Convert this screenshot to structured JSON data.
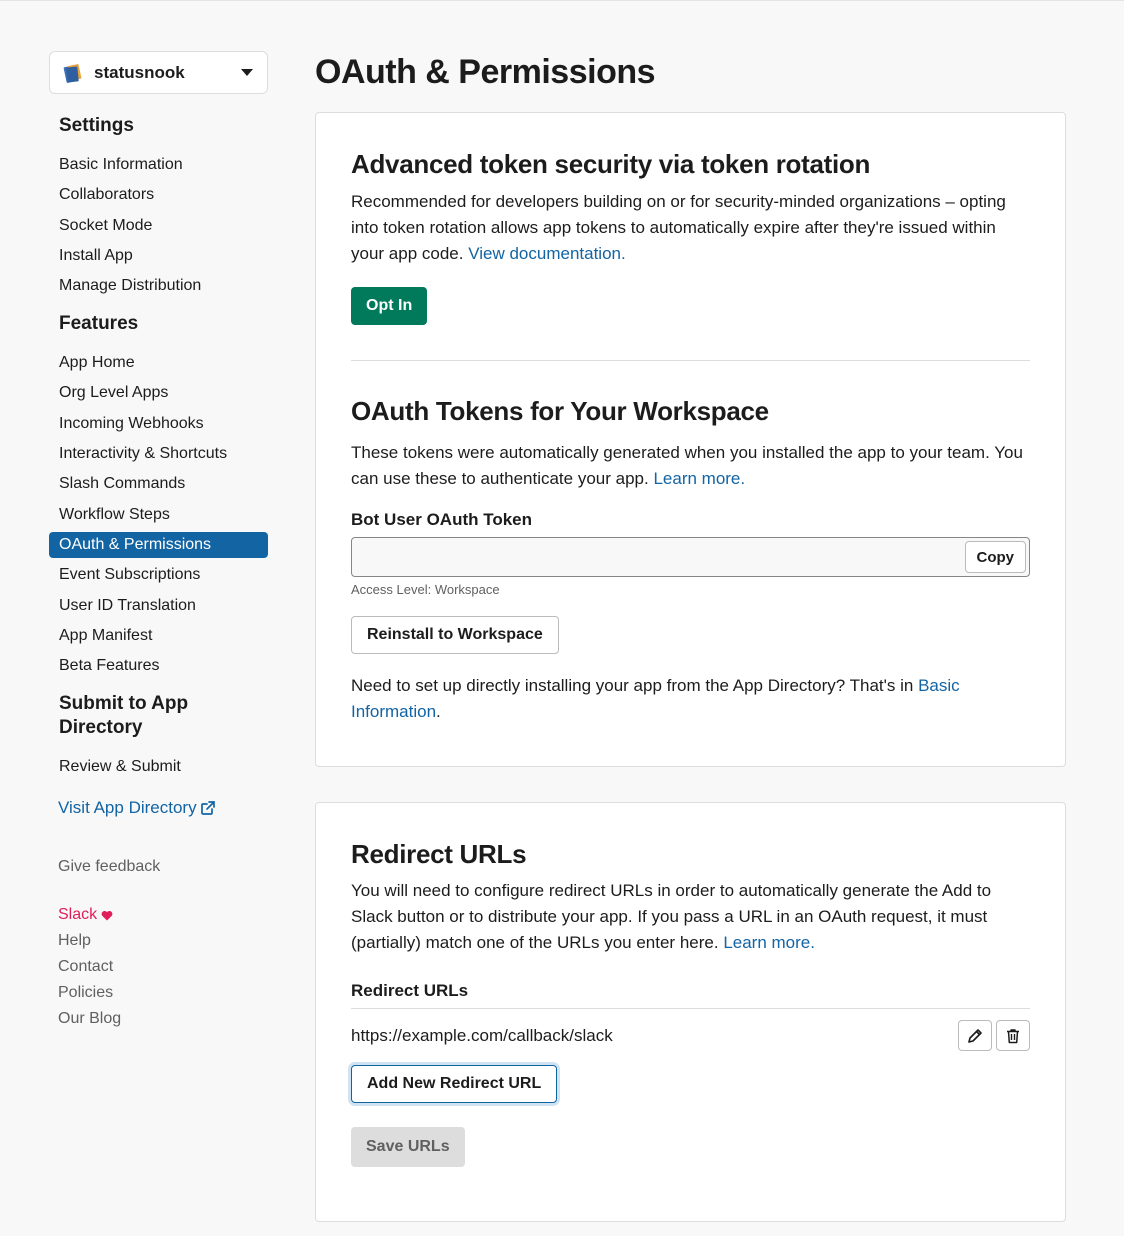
{
  "sidebar": {
    "app_name": "statusnook",
    "settings_heading": "Settings",
    "settings_items": [
      "Basic Information",
      "Collaborators",
      "Socket Mode",
      "Install App",
      "Manage Distribution"
    ],
    "features_heading": "Features",
    "features_items": [
      "App Home",
      "Org Level Apps",
      "Incoming Webhooks",
      "Interactivity & Shortcuts",
      "Slash Commands",
      "Workflow Steps",
      "OAuth & Permissions",
      "Event Subscriptions",
      "User ID Translation",
      "App Manifest",
      "Beta Features"
    ],
    "active_item": "OAuth & Permissions",
    "submit_heading_line1": "Submit to App",
    "submit_heading_line2": "Directory",
    "submit_items": [
      "Review & Submit"
    ],
    "visit_link": "Visit App Directory",
    "feedback": "Give feedback",
    "footer": {
      "slack": "Slack",
      "help": "Help",
      "contact": "Contact",
      "policies": "Policies",
      "blog": "Our Blog"
    }
  },
  "page": {
    "title": "OAuth & Permissions"
  },
  "token_rotation": {
    "heading": "Advanced token security via token rotation",
    "description": "Recommended for developers building on or for security-minded organizations – opting into token rotation allows app tokens to automatically expire after they're issued within your app code.",
    "doc_link": "View documentation.",
    "opt_in_label": "Opt In"
  },
  "oauth_tokens": {
    "heading": "OAuth Tokens for Your Workspace",
    "description": "These tokens were automatically generated when you installed the app to your team. You can use these to authenticate your app.",
    "learn_more": "Learn more.",
    "bot_token_label": "Bot User OAuth Token",
    "bot_token_value": "",
    "copy_label": "Copy",
    "access_level": "Access Level: Workspace",
    "reinstall_label": "Reinstall to Workspace",
    "directory_note": "Need to set up directly installing your app from the App Directory? That's in",
    "basic_info_link": "Basic Information",
    "period": "."
  },
  "redirect": {
    "heading": "Redirect URLs",
    "description": "You will need to configure redirect URLs in order to automatically generate the Add to Slack button or to distribute your app. If you pass a URL in an OAuth request, it must (partially) match one of the URLs you enter here.",
    "learn_more": "Learn more.",
    "list_label": "Redirect URLs",
    "urls": [
      "https://example.com/callback/slack"
    ],
    "add_label": "Add New Redirect URL",
    "save_label": "Save URLs"
  },
  "colors": {
    "accent": "#1264a3",
    "primary_button": "#007a5a",
    "heart": "#e01e5a"
  }
}
